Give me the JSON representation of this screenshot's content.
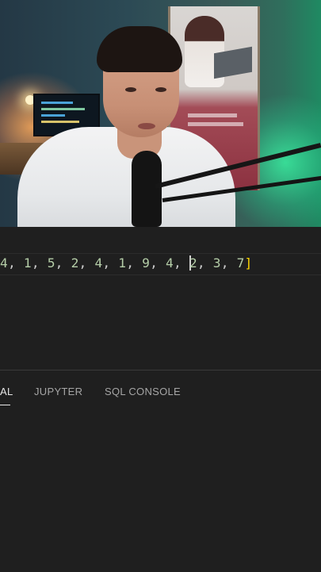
{
  "editor": {
    "line_tokens": [
      {
        "t": "4",
        "k": "num"
      },
      {
        "t": ", ",
        "k": "punc"
      },
      {
        "t": "1",
        "k": "num"
      },
      {
        "t": ", ",
        "k": "punc"
      },
      {
        "t": "5",
        "k": "num"
      },
      {
        "t": ", ",
        "k": "punc"
      },
      {
        "t": "2",
        "k": "num"
      },
      {
        "t": ", ",
        "k": "punc"
      },
      {
        "t": "4",
        "k": "num"
      },
      {
        "t": ", ",
        "k": "punc"
      },
      {
        "t": "1",
        "k": "num"
      },
      {
        "t": ", ",
        "k": "punc"
      },
      {
        "t": "9",
        "k": "num"
      },
      {
        "t": ", ",
        "k": "punc"
      },
      {
        "t": "4",
        "k": "num"
      },
      {
        "t": ", ",
        "k": "punc"
      },
      {
        "t": "|",
        "k": "cursor"
      },
      {
        "t": "2",
        "k": "num"
      },
      {
        "t": ", ",
        "k": "punc"
      },
      {
        "t": "3",
        "k": "num"
      },
      {
        "t": ", ",
        "k": "punc"
      },
      {
        "t": "7",
        "k": "num"
      },
      {
        "t": "]",
        "k": "bracket"
      }
    ],
    "colors": {
      "number": "#b5cea8",
      "punctuation": "#cccccc",
      "bracket": "#ffd700",
      "background": "#1f1f1f"
    }
  },
  "panel": {
    "tabs": [
      {
        "label": "AL",
        "active": true
      },
      {
        "label": "JUPYTER",
        "active": false
      },
      {
        "label": "SQL CONSOLE",
        "active": false
      }
    ]
  },
  "webcam": {
    "poster_lines": [
      "Weiterbildung",
      "Programmierer"
    ]
  }
}
